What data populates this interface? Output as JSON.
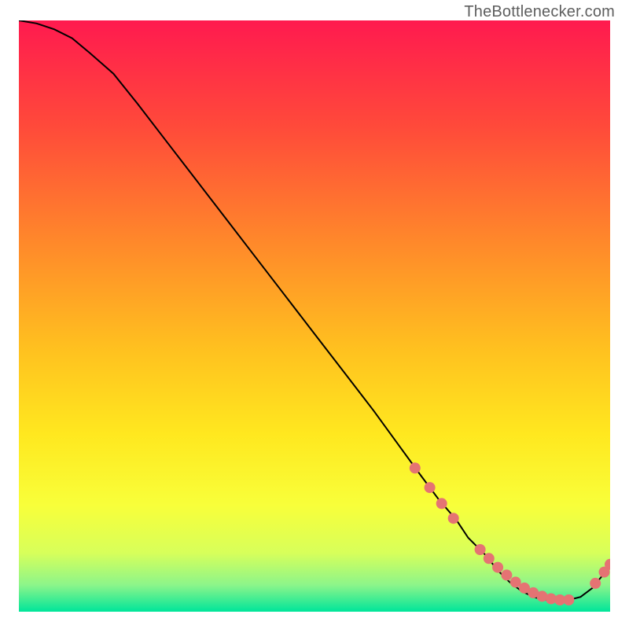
{
  "watermark": "TheBottlenecker.com",
  "chart_data": {
    "type": "line",
    "title": "",
    "xlabel": "",
    "ylabel": "",
    "xlim": [
      0,
      100
    ],
    "ylim": [
      0,
      100
    ],
    "grid": false,
    "legend": false,
    "series": [
      {
        "name": "curve",
        "style": "line",
        "color": "#000000",
        "x": [
          0,
          3,
          6,
          9,
          12,
          16,
          20,
          25,
          30,
          35,
          40,
          45,
          50,
          55,
          60,
          64,
          68,
          71,
          74,
          76,
          79,
          81,
          83,
          85,
          87,
          89,
          91,
          93,
          95,
          97,
          99,
          100
        ],
        "y": [
          100,
          99.5,
          98.5,
          97,
          94.5,
          91,
          86,
          79.5,
          73,
          66.5,
          60,
          53.5,
          47,
          40.5,
          34,
          28.5,
          23,
          19,
          15.5,
          12.5,
          9.5,
          7,
          5,
          3.5,
          2.5,
          2,
          2,
          2,
          2.5,
          4,
          6.5,
          8
        ]
      },
      {
        "name": "markers",
        "style": "scatter",
        "color": "#e57373",
        "x": [
          67,
          69.5,
          71.5,
          73.5,
          78,
          79.5,
          81,
          82.5,
          84,
          85.5,
          87,
          88.5,
          90,
          91.5,
          93,
          97.5,
          99,
          100
        ],
        "y": [
          24.3,
          21,
          18.3,
          15.8,
          10.5,
          9,
          7.5,
          6.2,
          5,
          4,
          3.2,
          2.6,
          2.2,
          2,
          2,
          4.8,
          6.7,
          8
        ]
      }
    ],
    "gradient_stops": [
      {
        "offset": 0,
        "color": "#ff1a4f"
      },
      {
        "offset": 0.18,
        "color": "#ff4a3a"
      },
      {
        "offset": 0.38,
        "color": "#ff8a2a"
      },
      {
        "offset": 0.56,
        "color": "#ffc21f"
      },
      {
        "offset": 0.7,
        "color": "#ffe81f"
      },
      {
        "offset": 0.82,
        "color": "#f8ff3a"
      },
      {
        "offset": 0.9,
        "color": "#d8ff5a"
      },
      {
        "offset": 0.955,
        "color": "#8cf58a"
      },
      {
        "offset": 1.0,
        "color": "#00e59a"
      }
    ]
  }
}
